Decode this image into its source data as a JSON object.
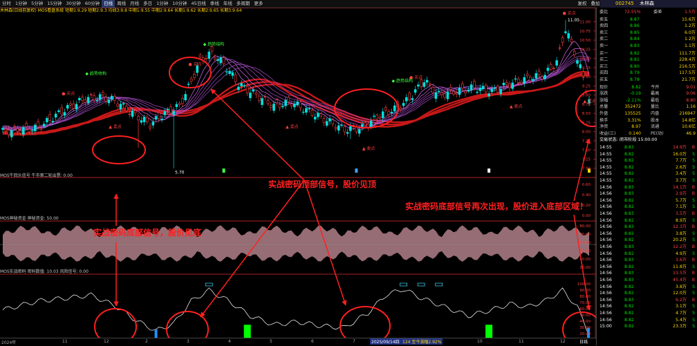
{
  "toolbar": {
    "periods": [
      "分时",
      "1分钟",
      "5分钟",
      "15分钟",
      "30分钟",
      "60分钟",
      "日线",
      "周线",
      "月线",
      "多日",
      "1分钟",
      "10分钟",
      "45日线",
      "季线",
      "年线",
      "多周期",
      "更多"
    ],
    "active_index": 6,
    "right": [
      "复权",
      "叠加",
      "多股",
      "统计",
      "画线",
      "F10",
      "标记",
      "+自选",
      "返回"
    ]
  },
  "stock": {
    "code": "002745",
    "name": "木林森"
  },
  "indicators": {
    "main": "木林森(日线前复权) MOS看盘系统 短期1:9.29 短期2:9.3 均线3:9.8 中期1:9.55 中期2:9.64 长期1:9.62 长期2:9.65 长期3:9.64",
    "p2": "MOS牛回头信号 牛市第二轮出票: 0.00",
    "p3": "MOS神秘资金 神秘资金: 50.00",
    "p4": "MOS实战密码 密码数值: 10.03 风险信号: 0.00"
  },
  "chart_labels": {
    "top_price": "11.05",
    "low_price": "5.70",
    "buy": "买点",
    "sell": "卖点",
    "band": "趋势结构"
  },
  "price_axis": [
    "11.00",
    "10.75",
    "10.50",
    "10.25",
    "10.00",
    "9.75",
    "9.50",
    "9.25",
    "9.00",
    "8.75",
    "8.50",
    "8.25",
    "8.00",
    "7.75",
    "7.50",
    "7.25",
    "7.00"
  ],
  "p2_axis": [
    "0.60",
    "0.40",
    "0.20",
    "0.00"
  ],
  "p3_axis": [
    "80.00",
    "70.00",
    "60.00",
    "50.00",
    "40.00",
    "30.00"
  ],
  "p4_axis": [
    "100.00",
    "90.00",
    "80.00",
    "70.00",
    "60.00",
    "50.00",
    "40.00",
    "30.00",
    "20.00",
    "10.00"
  ],
  "annotations": {
    "top": "实战密码顶部信号，股价见顶",
    "bottom": "实战密码底部信号，股价见底",
    "bottom_again": "实战密码底部信号再次出现，股价进入底部区域！"
  },
  "bottom_axis": {
    "labels": [
      "2024年",
      "11",
      "12",
      "2",
      "3",
      "4",
      "5",
      "6",
      "7",
      "8",
      "9",
      "10",
      "11",
      "12"
    ],
    "date_box": "2025/09/14四",
    "info_box": "124 至今涨幅2.92%",
    "period": "日线"
  },
  "panel": {
    "ratio_label": "委比",
    "ratio": "72.55%",
    "diff_label": "委差",
    "diff": "1.5万",
    "asks": [
      {
        "label": "卖五",
        "price": "8.87",
        "vol": "15.6万"
      },
      {
        "label": "卖四",
        "price": "8.86",
        "vol": "1.2万"
      },
      {
        "label": "卖三",
        "price": "8.85",
        "vol": "6.0万"
      },
      {
        "label": "卖二",
        "price": "8.84",
        "vol": "1.2万"
      },
      {
        "label": "卖一",
        "price": "8.83",
        "vol": "1.1万"
      }
    ],
    "bids": [
      {
        "label": "买一",
        "price": "8.82",
        "vol": "111.7万"
      },
      {
        "label": "买二",
        "price": "8.81",
        "vol": "228.4万"
      },
      {
        "label": "买三",
        "price": "8.80",
        "vol": "216.5万"
      },
      {
        "label": "买四",
        "price": "8.79",
        "vol": "117.5万"
      },
      {
        "label": "买五",
        "price": "8.78",
        "vol": "21.7万"
      }
    ],
    "quote": [
      {
        "l1": "现价",
        "v1": "8.82",
        "l2": "今开",
        "v2": "9.01"
      },
      {
        "l1": "涨跌",
        "v1": "-0.19",
        "l2": "最高",
        "v2": "9.06"
      },
      {
        "l1": "涨幅",
        "v1": "-2.11%",
        "l2": "最低",
        "v2": "8.80"
      },
      {
        "l1": "总量",
        "v1": "352472",
        "l2": "量比",
        "v2": "1.16"
      },
      {
        "l1": "外盘",
        "v1": "135525",
        "l2": "内盘",
        "v2": "216947"
      },
      {
        "l1": "换手",
        "v1": "3.31%",
        "l2": "股本",
        "v2": "14.8亿"
      },
      {
        "l1": "净资",
        "v1": "8.97",
        "l2": "流通",
        "v2": "10.6亿"
      },
      {
        "l1": "收益(三)",
        "v1": "0.140",
        "l2": "PE(动)",
        "v2": "46.9"
      }
    ],
    "status": "交易状态: 闭市阶段 15:00:00",
    "ticks": [
      {
        "t": "14:55",
        "p": "8.83",
        "v": "14.9万",
        "s": "B"
      },
      {
        "t": "14:55",
        "p": "8.82",
        "v": "16.0万",
        "s": "S"
      },
      {
        "t": "14:55",
        "p": "8.82",
        "v": "7.7万",
        "s": "S"
      },
      {
        "t": "14:55",
        "p": "8.82",
        "v": "2.6万",
        "s": "S"
      },
      {
        "t": "14:55",
        "p": "8.82",
        "v": "3.4万",
        "s": "S"
      },
      {
        "t": "14:55",
        "p": "8.82",
        "v": "3.7万",
        "s": "S"
      },
      {
        "t": "14:56",
        "p": "8.83",
        "v": "14.1万",
        "s": "B"
      },
      {
        "t": "14:56",
        "p": "8.83",
        "v": "2.9万",
        "s": "B"
      },
      {
        "t": "14:56",
        "p": "8.82",
        "v": "5.7万",
        "s": "S"
      },
      {
        "t": "14:56",
        "p": "8.82",
        "v": "7.1万",
        "s": "S"
      },
      {
        "t": "14:56",
        "p": "8.83",
        "v": "3.5万",
        "s": "B"
      },
      {
        "t": "14:56",
        "p": "8.82",
        "v": "8.9万",
        "s": "S"
      },
      {
        "t": "14:56",
        "p": "8.83",
        "v": "12.3万",
        "s": "B"
      },
      {
        "t": "14:56",
        "p": "8.82",
        "v": "3.8万",
        "s": "S"
      },
      {
        "t": "14:56",
        "p": "8.82",
        "v": "20.2万",
        "s": "S"
      },
      {
        "t": "14:56",
        "p": "8.83",
        "v": "12.2万",
        "s": "B"
      },
      {
        "t": "14:56",
        "p": "8.82",
        "v": "4.9万",
        "s": "S"
      },
      {
        "t": "14:56",
        "p": "8.83",
        "v": "3.6万",
        "s": "B"
      },
      {
        "t": "14:56",
        "p": "8.82",
        "v": "11.8万",
        "s": "S"
      },
      {
        "t": "14:56",
        "p": "8.83",
        "v": "13.5万",
        "s": "B"
      },
      {
        "t": "14:56",
        "p": "8.83",
        "v": "45.4万",
        "s": "B"
      },
      {
        "t": "14:56",
        "p": "8.82",
        "v": "3.8万",
        "s": "S"
      },
      {
        "t": "14:56",
        "p": "8.82",
        "v": "12.0万",
        "s": "S"
      },
      {
        "t": "14:56",
        "p": "8.83",
        "v": "6.2万",
        "s": "B"
      },
      {
        "t": "14:56",
        "p": "8.82",
        "v": "3.1万",
        "s": "S"
      },
      {
        "t": "14:56",
        "p": "8.82",
        "v": "4.7万",
        "s": "S"
      },
      {
        "t": "14:56",
        "p": "8.82",
        "v": "5.4万",
        "s": "S"
      },
      {
        "t": "15:00",
        "p": "8.82",
        "v": "23.3万",
        "s": "S"
      }
    ]
  },
  "colors": {
    "up": "#ff4040",
    "down": "#00e0e0",
    "ma_red": "#c81818",
    "ma_purple": "#b050d0",
    "signal": "#00ff00",
    "wave": "#b08088"
  }
}
